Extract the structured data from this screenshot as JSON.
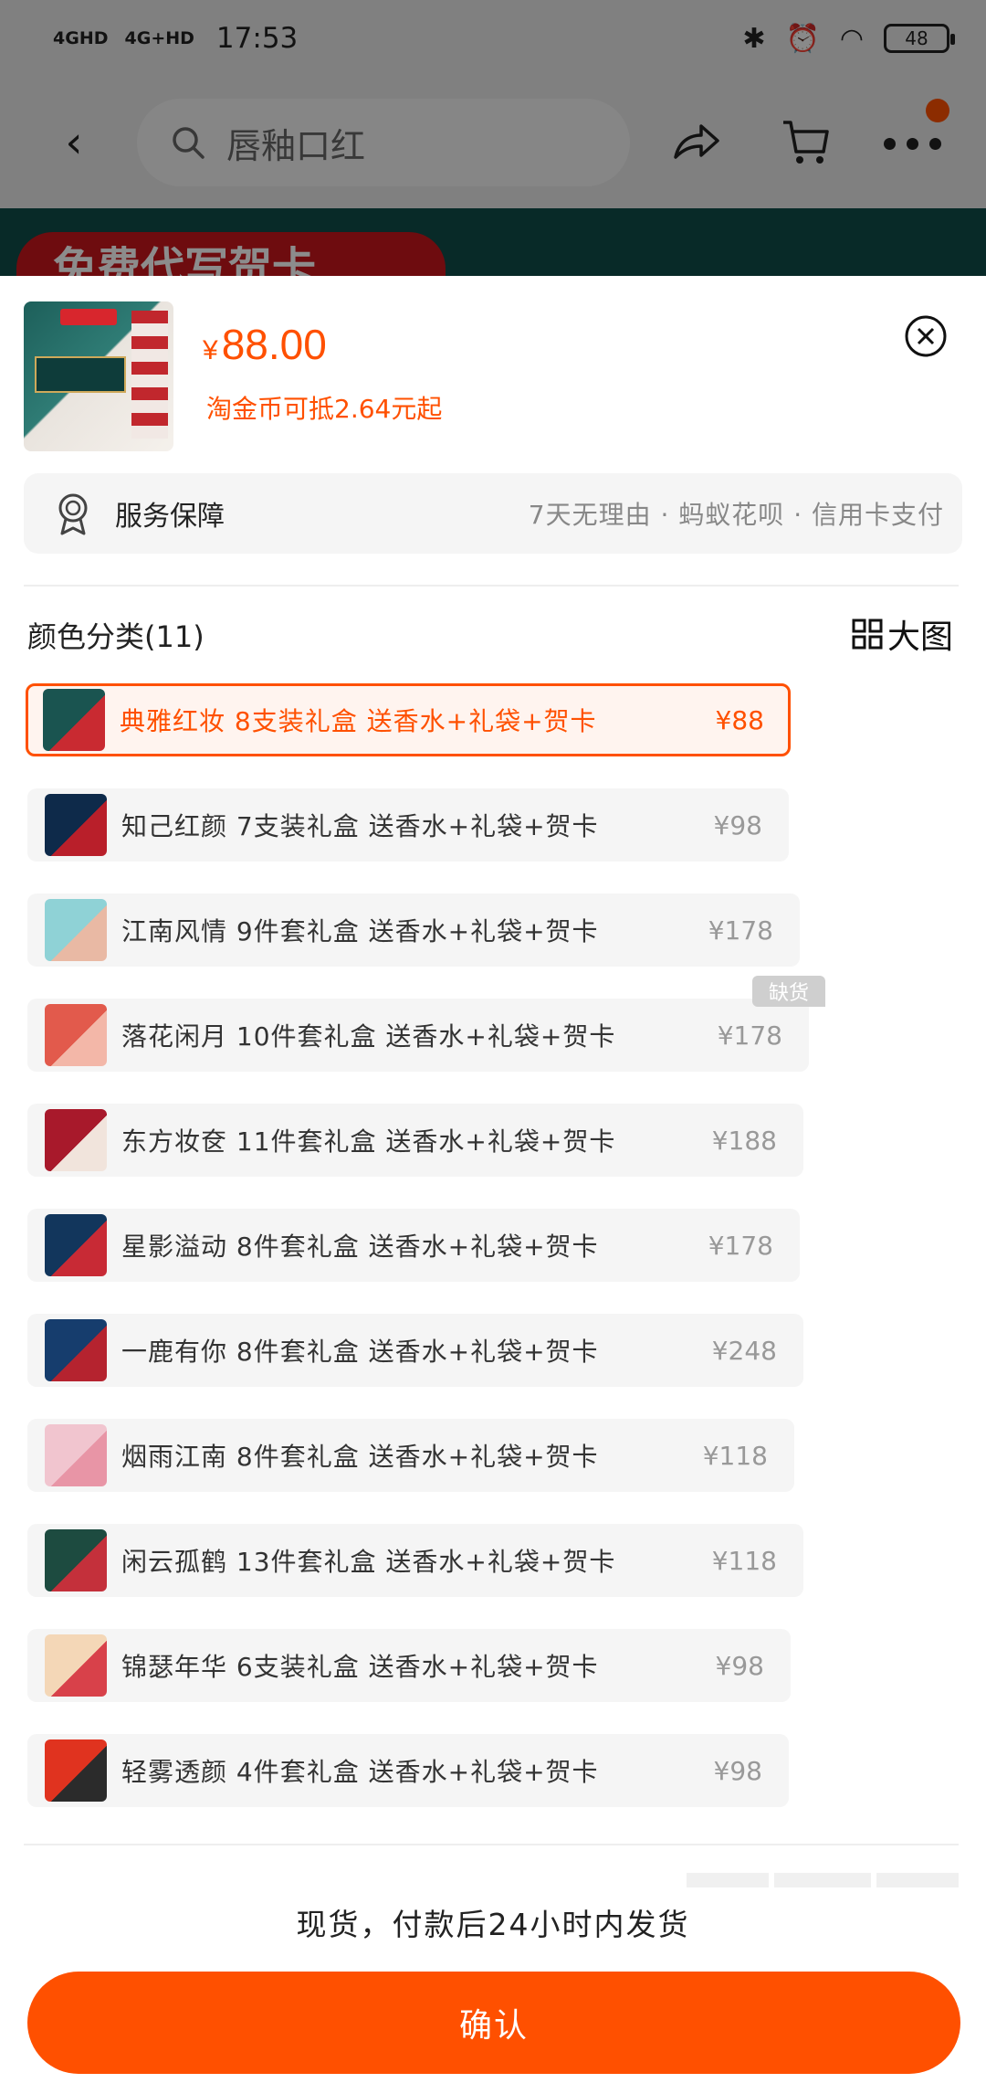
{
  "status_bar": {
    "network_1": "4GHD",
    "network_2": "4G+HD",
    "time": "17:53",
    "battery": "48"
  },
  "search": {
    "placeholder": "唇釉口红"
  },
  "banner": {
    "text": "免费代写贺卡"
  },
  "product": {
    "currency": "¥",
    "price": "88.00",
    "coin_note": "淘金币可抵2.64元起"
  },
  "service": {
    "label": "服务保障",
    "items": "7天无理由 · 蚂蚁花呗 · 信用卡支付"
  },
  "category": {
    "title": "颜色分类(11)",
    "big_image_label": "大图"
  },
  "options": [
    {
      "name": "典雅红妆 8支装礼盒 送香水+礼袋+贺卡",
      "price": "¥88",
      "selected": true,
      "thumb": [
        "#1a5450",
        "#c92a31"
      ]
    },
    {
      "name": "知己红颜 7支装礼盒 送香水+礼袋+贺卡",
      "price": "¥98",
      "selected": false,
      "thumb": [
        "#0e2a4a",
        "#b91f2a"
      ]
    },
    {
      "name": "江南风情 9件套礼盒 送香水+礼袋+贺卡",
      "price": "¥178",
      "selected": false,
      "thumb": [
        "#8fd2d6",
        "#e9b9a4"
      ]
    },
    {
      "name": "落花闲月 10件套礼盒 送香水+礼袋+贺卡",
      "price": "¥178",
      "selected": false,
      "thumb": [
        "#e25a4c",
        "#f3b7a8"
      ],
      "out_of_stock": true
    },
    {
      "name": "东方妆奁 11件套礼盒 送香水+礼袋+贺卡",
      "price": "¥188",
      "selected": false,
      "thumb": [
        "#a8192b",
        "#f1e4dc"
      ]
    },
    {
      "name": "星影溢动 8件套礼盒 送香水+礼袋+贺卡",
      "price": "¥178",
      "selected": false,
      "thumb": [
        "#12365c",
        "#c82a35"
      ]
    },
    {
      "name": "一鹿有你 8件套礼盒 送香水+礼袋+贺卡",
      "price": "¥248",
      "selected": false,
      "thumb": [
        "#163d6d",
        "#b5232f"
      ]
    },
    {
      "name": "烟雨江南 8件套礼盒 送香水+礼袋+贺卡",
      "price": "¥118",
      "selected": false,
      "thumb": [
        "#f1c5cf",
        "#e895a6"
      ]
    },
    {
      "name": "闲云孤鹤 13件套礼盒 送香水+礼袋+贺卡",
      "price": "¥118",
      "selected": false,
      "thumb": [
        "#1d4b40",
        "#c4303b"
      ]
    },
    {
      "name": "锦瑟年华 6支装礼盒 送香水+礼袋+贺卡",
      "price": "¥98",
      "selected": false,
      "thumb": [
        "#f4d7b7",
        "#d8414a"
      ]
    },
    {
      "name": "轻雾透颜 4件套礼盒 送香水+礼袋+贺卡",
      "price": "¥98",
      "selected": false,
      "thumb": [
        "#e0331f",
        "#2b2b2b"
      ]
    }
  ],
  "stock_badge": "缺货",
  "shipping_note": "现货，付款后24小时内发货",
  "confirm_label": "确认",
  "colors": {
    "accent": "#ff5000",
    "option_bg": "#f5f5f5"
  }
}
